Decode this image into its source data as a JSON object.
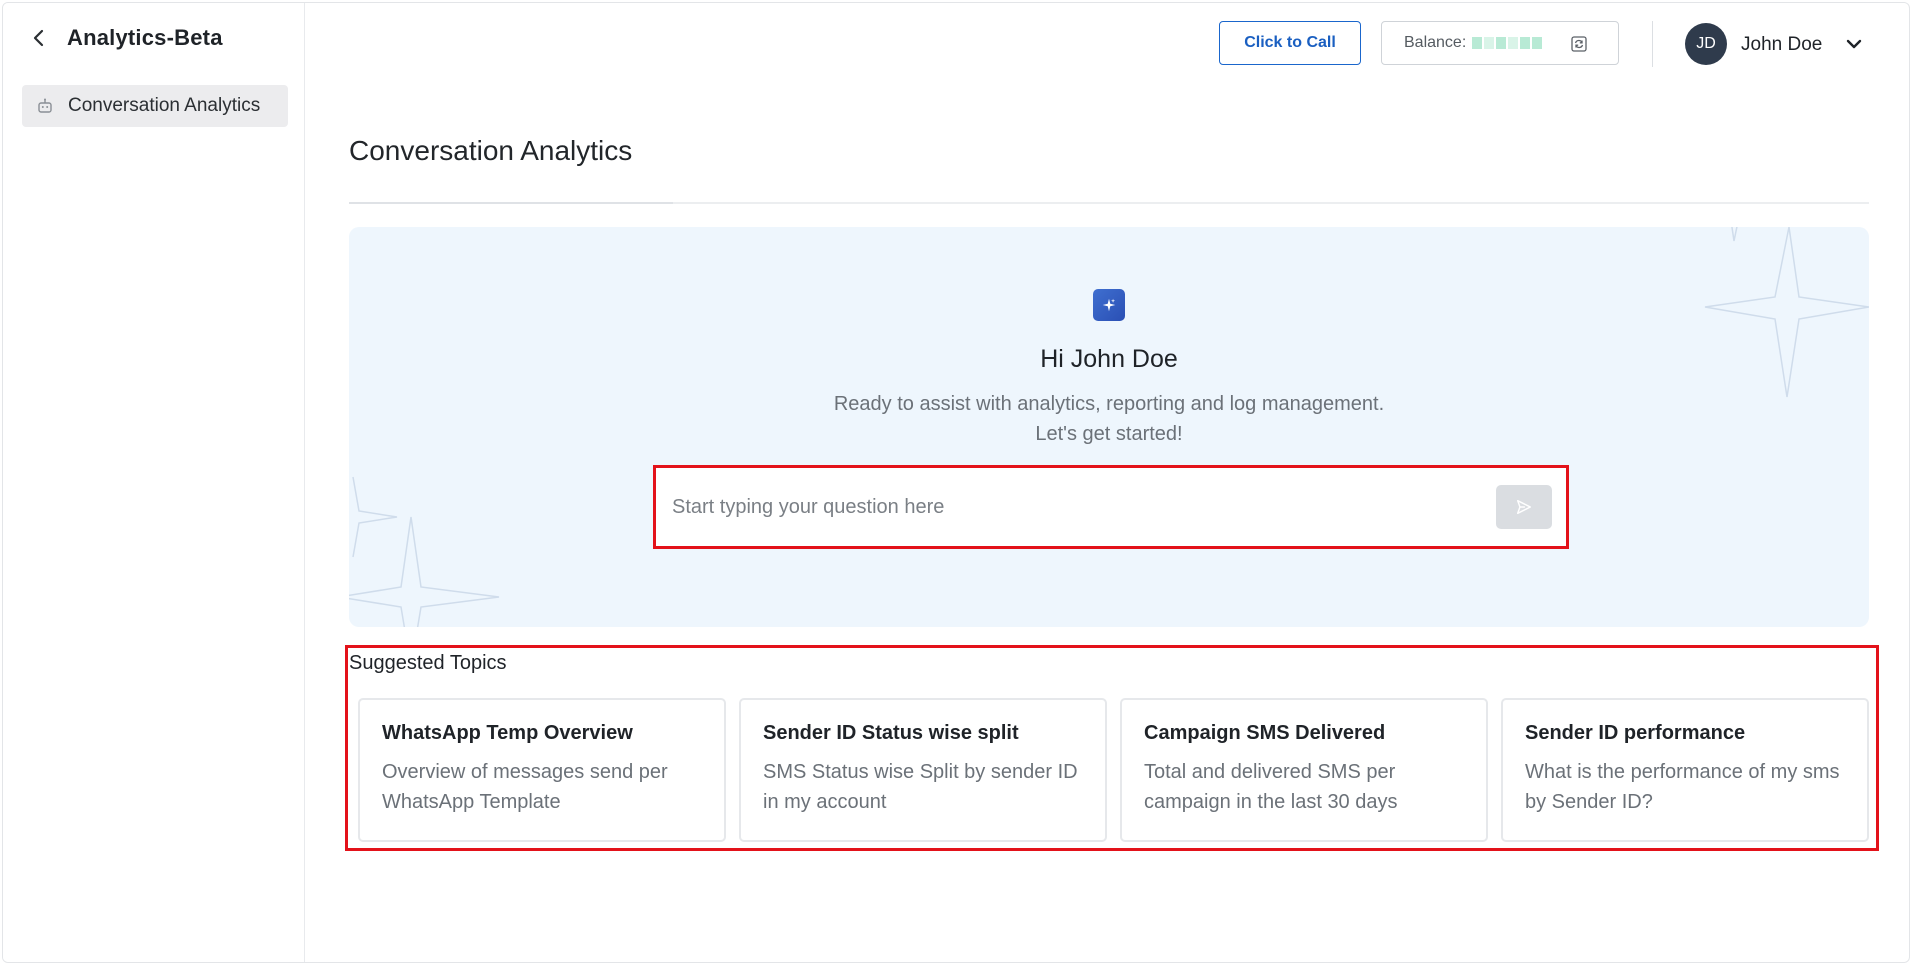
{
  "sidebar": {
    "app_title": "Analytics-Beta",
    "items": [
      {
        "label": "Conversation Analytics",
        "icon": "robot-icon",
        "active": true
      }
    ]
  },
  "header": {
    "click_to_call_label": "Click to Call",
    "balance_label": "Balance:",
    "user_initials": "JD",
    "user_name": "John Doe"
  },
  "main": {
    "page_title": "Conversation Analytics",
    "hero": {
      "greeting": "Hi John Doe",
      "subtitle_line1": "Ready to assist with analytics, reporting and log management.",
      "subtitle_line2": "Let's get started!",
      "input_placeholder": "Start typing your question here"
    },
    "suggested_topics": {
      "title": "Suggested Topics",
      "cards": [
        {
          "title": "WhatsApp Temp Overview",
          "description": "Overview of messages send per WhatsApp Template"
        },
        {
          "title": "Sender ID Status wise split",
          "description": "SMS Status wise Split by sender ID in my account"
        },
        {
          "title": "Campaign SMS Delivered",
          "description": "Total and delivered SMS per campaign in the last 30 days"
        },
        {
          "title": "Sender ID performance",
          "description": "What is the performance of my sms by Sender ID?"
        }
      ]
    }
  },
  "colors": {
    "accent_blue": "#1a5fc1",
    "hero_bg": "#eef6fd",
    "highlight_red": "#e3121a",
    "avatar_bg": "#2f3b4c"
  }
}
